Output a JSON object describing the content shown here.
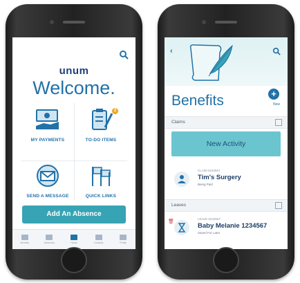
{
  "left_phone": {
    "brand": "unum",
    "welcome": "Welcome.",
    "tiles": [
      {
        "label": "MY PAYMENTS",
        "icon": "money-hand-icon"
      },
      {
        "label": "TO-DO ITEMS",
        "icon": "clipboard-pencil-icon",
        "badge": "2"
      },
      {
        "label": "SEND A MESSAGE",
        "icon": "envelope-icon"
      },
      {
        "label": "QUICK LINKS",
        "icon": "flags-icon"
      }
    ],
    "primary_button": "Add An Absence",
    "tabbar": [
      "Benefits",
      "Absences",
      "Home",
      "Contacts",
      "Profile"
    ],
    "active_tab": "Home"
  },
  "right_phone": {
    "title": "Benefits",
    "new_label": "New",
    "claims_header": "Claims",
    "new_activity": "New Activity",
    "claim": {
      "id": "CLAIM 5234567",
      "title": "Tim's Surgery",
      "status": "Being Paid"
    },
    "leaves_header": "Leaves",
    "leave": {
      "id": "LEAVE 5234567",
      "title": "Baby Melanie 1234567",
      "status": "Saved For Later"
    }
  },
  "colors": {
    "primary": "#2271a8",
    "teal": "#36a4b4",
    "teal_light": "#6ac5cf",
    "badge": "#f0a81c"
  }
}
